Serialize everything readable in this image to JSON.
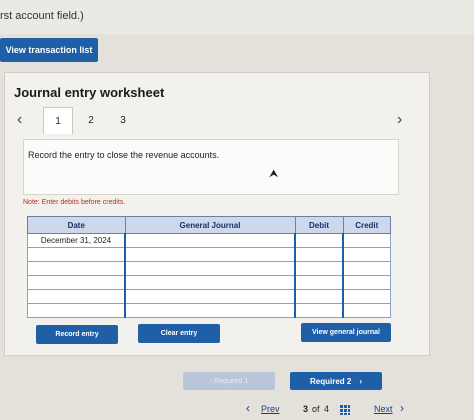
{
  "header": {
    "partial_text": "rst account field.)"
  },
  "view_transaction_label": "View transaction list",
  "worksheet": {
    "title": "Journal entry worksheet",
    "tabs": [
      "1",
      "2",
      "3"
    ],
    "active_tab": "1",
    "instruction": "Record the entry to close the revenue accounts.",
    "note": "Note: Enter debits before credits.",
    "columns": [
      "Date",
      "General Journal",
      "Debit",
      "Credit"
    ],
    "rows": [
      {
        "date": "December 31, 2024",
        "account": "",
        "debit": "",
        "credit": ""
      },
      {
        "date": "",
        "account": "",
        "debit": "",
        "credit": ""
      },
      {
        "date": "",
        "account": "",
        "debit": "",
        "credit": ""
      },
      {
        "date": "",
        "account": "",
        "debit": "",
        "credit": ""
      },
      {
        "date": "",
        "account": "",
        "debit": "",
        "credit": ""
      },
      {
        "date": "",
        "account": "",
        "debit": "",
        "credit": ""
      }
    ],
    "buttons": {
      "record": "Record entry",
      "clear": "Clear entry",
      "view_journal": "View general journal"
    }
  },
  "requirements": {
    "prev_label": "Required 1",
    "next_label": "Required 2"
  },
  "pagination": {
    "prev": "Prev",
    "page_current": "3",
    "of_label": "of",
    "page_total": "4",
    "next": "Next"
  },
  "colors": {
    "accent": "#1f5fa8",
    "note": "#b0341e",
    "header_bg": "#cdd8ea"
  }
}
